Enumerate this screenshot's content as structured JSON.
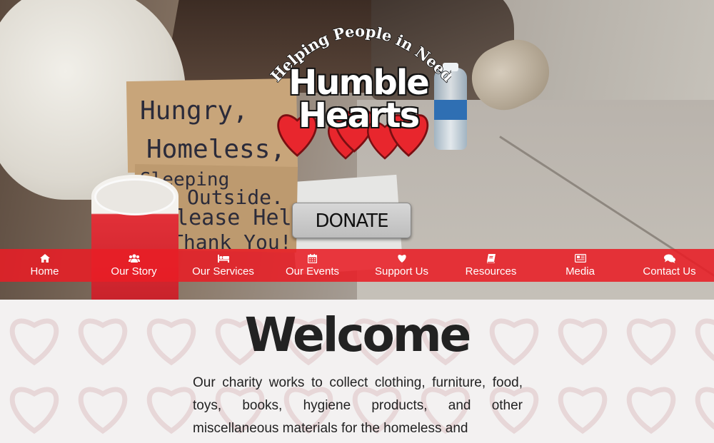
{
  "logo": {
    "tagline": "Helping People in Need",
    "brand_line1": "Humble",
    "brand_line2": "Hearts"
  },
  "hero_sign_lines": [
    "Hungry,",
    "Homeless,",
    "Sleeping",
    "Outside.",
    "Please Help.",
    "Thank You!"
  ],
  "donate_label": "DONATE",
  "nav": {
    "items": [
      {
        "label": "Home",
        "icon": "home-icon"
      },
      {
        "label": "Our Story",
        "icon": "users-icon"
      },
      {
        "label": "Our Services",
        "icon": "bed-icon"
      },
      {
        "label": "Our Events",
        "icon": "calendar-icon"
      },
      {
        "label": "Support Us",
        "icon": "heart-icon"
      },
      {
        "label": "Resources",
        "icon": "book-icon"
      },
      {
        "label": "Media",
        "icon": "newspaper-icon"
      },
      {
        "label": "Contact Us",
        "icon": "comments-icon"
      }
    ]
  },
  "main": {
    "heading": "Welcome",
    "intro": "Our charity works to collect clothing, furniture, food, toys, books, hygiene products, and other miscellaneous materials for the homeless and"
  },
  "colors": {
    "nav_red": "#e81e26",
    "heart_red": "#e8262d",
    "heading_text": "#222222"
  }
}
